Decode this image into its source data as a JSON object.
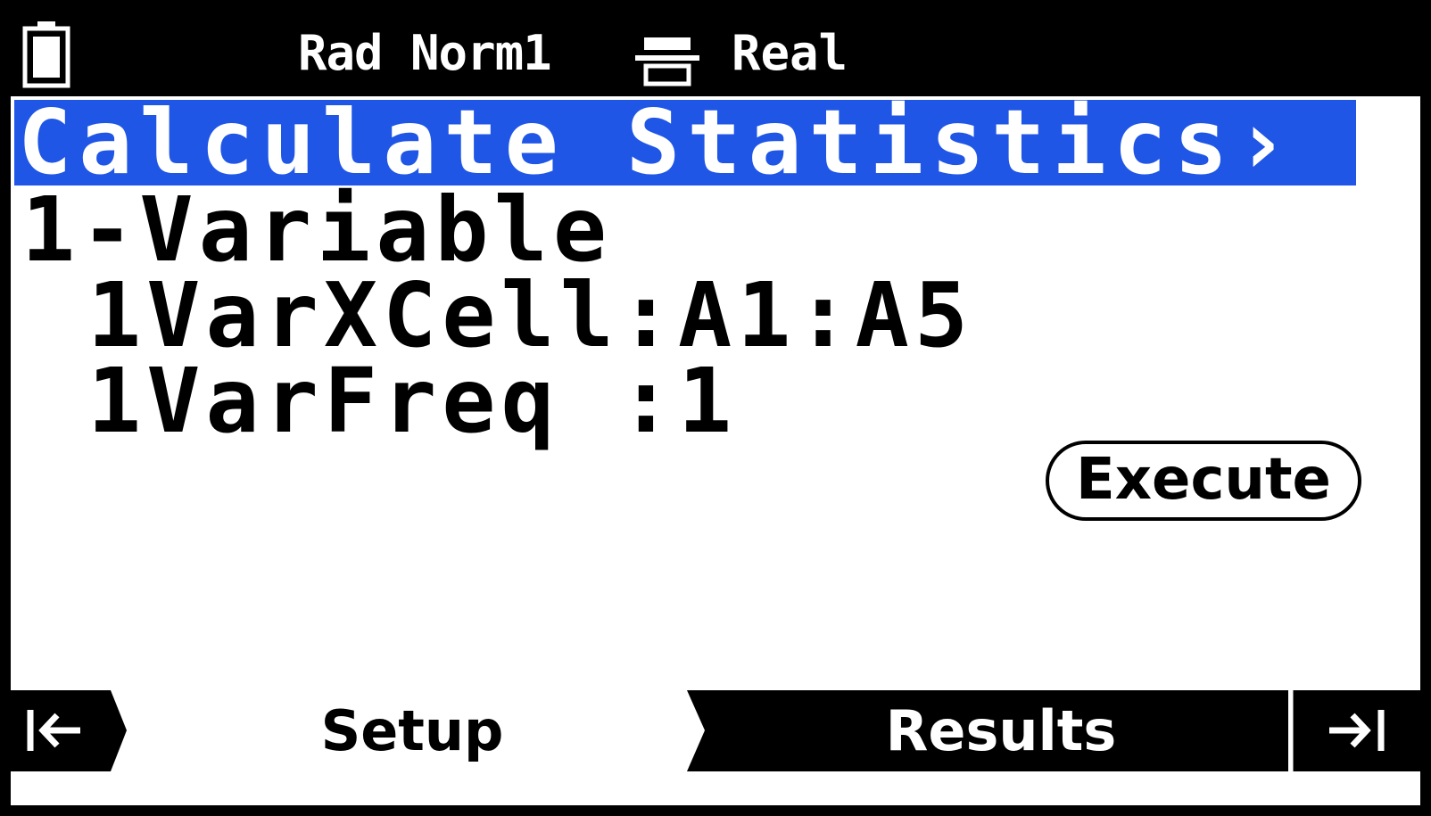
{
  "status_bar": {
    "battery_icon": "battery-icon",
    "mode": "Rad Norm1",
    "display_icon": "display-format-icon",
    "complex_mode": "Real"
  },
  "title": "Calculate Statistics›",
  "content": {
    "line_1": "1-Variable",
    "line_2": "1VarXCell:A1:A5",
    "line_3": "1VarFreq :1"
  },
  "execute_label": "Execute",
  "tabs": {
    "prev_icon": "first-tab-arrow-icon",
    "setup_label": "Setup",
    "results_label": "Results",
    "next_icon": "last-tab-arrow-icon"
  },
  "colors": {
    "title_bar": "#1f56e6",
    "status_bar": "#000000",
    "background": "#ffffff"
  }
}
